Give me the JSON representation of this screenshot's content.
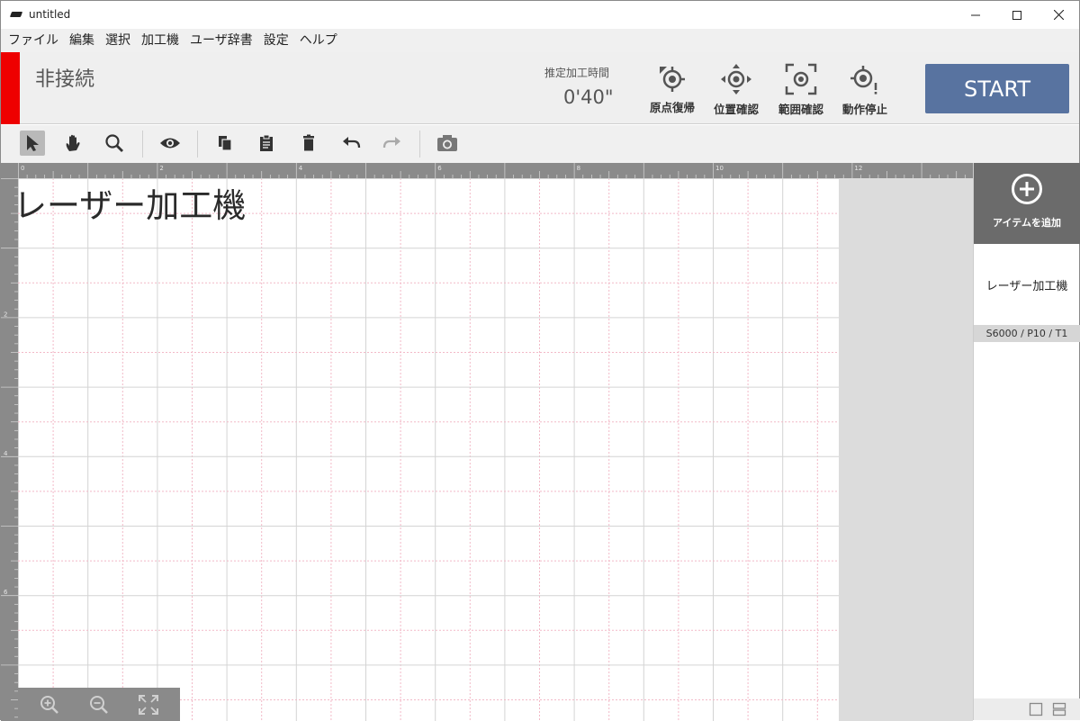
{
  "window": {
    "title": "untitled",
    "minimize": "─",
    "maximize": "☐",
    "close": "✕"
  },
  "menu": [
    {
      "label": "ファイル"
    },
    {
      "label": "編集"
    },
    {
      "label": "選択"
    },
    {
      "label": "加工機"
    },
    {
      "label": "ユーザ辞書"
    },
    {
      "label": "設定"
    },
    {
      "label": "ヘルプ"
    }
  ],
  "header": {
    "connection_status": "非接続",
    "connection_color": "#ee0000",
    "estimate_label": "推定加工時間",
    "estimate_value": "0'40\"",
    "buttons": [
      {
        "label": "原点復帰",
        "icon": "home-target-icon"
      },
      {
        "label": "位置確認",
        "icon": "position-move-icon"
      },
      {
        "label": "範囲確認",
        "icon": "range-check-icon"
      },
      {
        "label": "動作停止",
        "icon": "stop-target-icon"
      }
    ],
    "start_label": "START",
    "start_color": "#5873a0"
  },
  "toolbar": {
    "tools": [
      "select-arrow-icon",
      "hand-pan-icon",
      "magnifier-icon",
      "eye-preview-icon",
      "copy-icon",
      "paste-clipboard-icon",
      "trash-icon",
      "undo-icon",
      "redo-icon",
      "camera-icon"
    ]
  },
  "canvas": {
    "text": "レーザー加工機",
    "ruler_top_labels": [
      "0",
      "2",
      "4",
      "6",
      "8",
      "10",
      "12"
    ],
    "ruler_left_labels": [
      "2",
      "4",
      "6"
    ]
  },
  "zoom": {
    "tools": [
      "zoom-in-icon",
      "zoom-out-icon",
      "fit-screen-icon"
    ]
  },
  "panel": {
    "add_label": "アイテムを追加",
    "item_title": "レーザー加工機",
    "item_params": "S6000 / P10 / T1"
  }
}
